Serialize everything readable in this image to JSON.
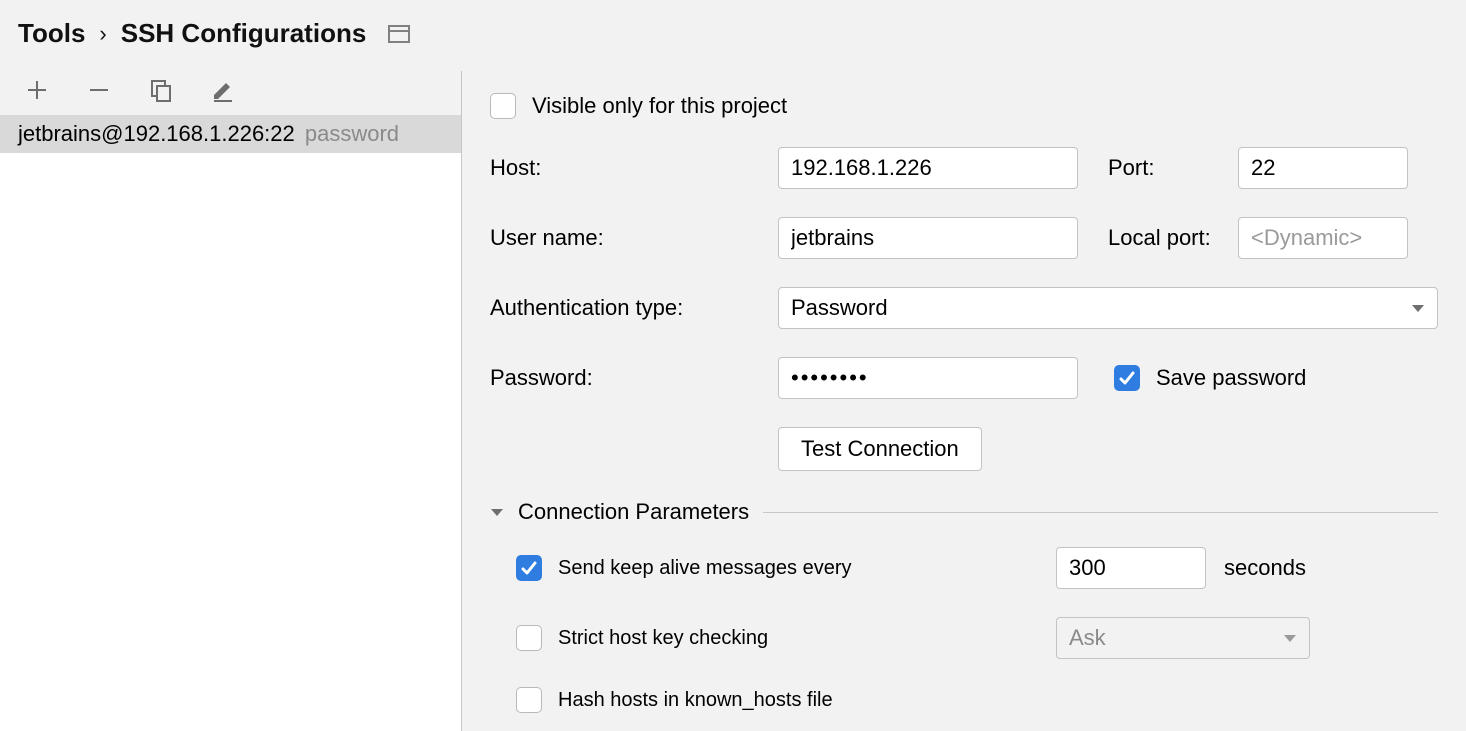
{
  "breadcrumb": {
    "root": "Tools",
    "leaf": "SSH Configurations"
  },
  "toolbar": {
    "add": "Add",
    "remove": "Remove",
    "copy": "Copy",
    "edit": "Edit"
  },
  "list": {
    "items": [
      {
        "label": "jetbrains@192.168.1.226:22",
        "tag": "password",
        "selected": true
      }
    ]
  },
  "form": {
    "visible_only_label": "Visible only for this project",
    "visible_only_checked": false,
    "host_label": "Host:",
    "host_value": "192.168.1.226",
    "port_label": "Port:",
    "port_value": "22",
    "user_label": "User name:",
    "user_value": "jetbrains",
    "localport_label": "Local port:",
    "localport_value": "",
    "localport_placeholder": "<Dynamic>",
    "authtype_label": "Authentication type:",
    "authtype_value": "Password",
    "password_label": "Password:",
    "password_value": "••••••••",
    "save_password_label": "Save password",
    "save_password_checked": true,
    "test_button": "Test Connection"
  },
  "connparams": {
    "title": "Connection Parameters",
    "keepalive_label": "Send keep alive messages every",
    "keepalive_checked": true,
    "keepalive_value": "300",
    "keepalive_unit": "seconds",
    "strict_label": "Strict host key checking",
    "strict_checked": false,
    "strict_select_value": "Ask",
    "hash_label": "Hash hosts in known_hosts file",
    "hash_checked": false
  }
}
